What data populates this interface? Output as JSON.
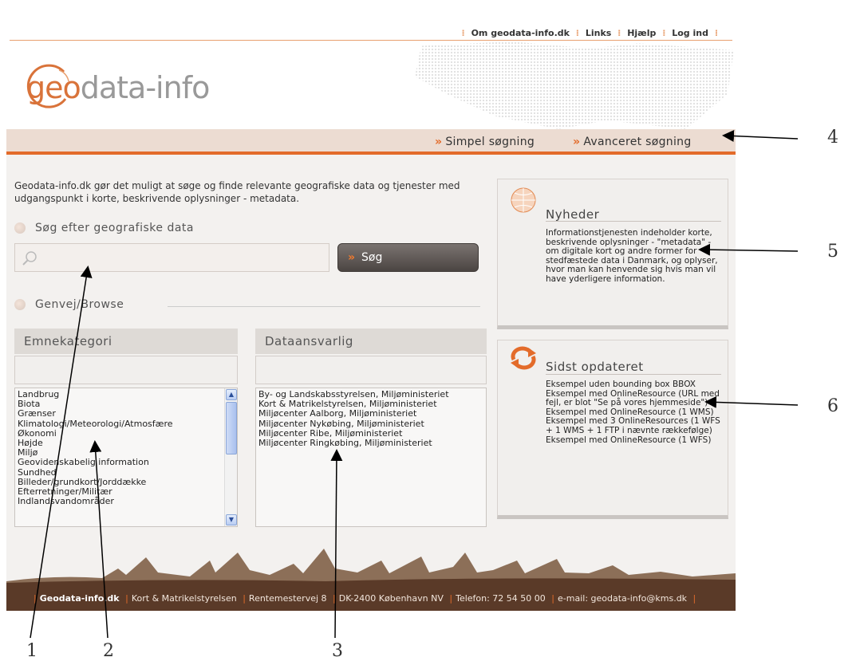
{
  "topnav": {
    "items": [
      "Om geodata-info.dk",
      "Links",
      "Hjælp",
      "Log ind"
    ]
  },
  "logo": {
    "prefix": "geo",
    "suffix": "data-info"
  },
  "searchstrip": {
    "simple": "Simpel søgning",
    "advanced": "Avanceret søgning"
  },
  "intro": "Geodata-info.dk gør det muligt at søge og finde relevante geografiske data og tjenester med udgangspunkt i korte, beskrivende oplysninger - metadata.",
  "search": {
    "heading": "Søg efter geografiske data",
    "value": "",
    "button": "Søg"
  },
  "browse": {
    "heading": "Genvej/Browse",
    "categories": {
      "title": "Emnekategori",
      "items": [
        "Landbrug",
        "Biota",
        "Grænser",
        "Klimatologi/Meteorologi/Atmosfære",
        "Økonomi",
        "Højde",
        "Miljø",
        "Geovidenskabelig information",
        "Sundhed",
        "Billeder/grundkort/Jorddække",
        "Efterretninger/Militær",
        "Indlandsvandområder"
      ]
    },
    "responsible": {
      "title": "Dataansvarlig",
      "items": [
        "By- og Landskabsstyrelsen, Miljøministeriet",
        "Kort & Matrikelstyrelsen, Miljøministeriet",
        "Miljøcenter Aalborg, Miljøministeriet",
        "Miljøcenter Nykøbing, Miljøministeriet",
        "Miljøcenter Ribe, Miljøministeriet",
        "Miljøcenter Ringkøbing, Miljøministeriet"
      ]
    }
  },
  "news": {
    "title": "Nyheder",
    "body": "Informationstjenesten indeholder korte, beskrivende oplysninger - \"metadata\" - om digitale kort og andre former for stedfæstede data i Danmark, og oplyser, hvor man kan henvende sig hvis man vil have yderligere information."
  },
  "updates": {
    "title": "Sidst opdateret",
    "items": [
      "Eksempel uden bounding box BBOX",
      "Eksempel med OnlineResource (URL med fejl, er blot \"Se på vores hjemmeside\")",
      "Eksempel med OnlineResource (1 WMS)",
      "Eksempel med 3 OnlineResources (1 WFS + 1 WMS + 1 FTP i nævnte rækkefølge)",
      "Eksempel med OnlineResource (1 WFS)"
    ]
  },
  "footer": {
    "site": "Geodata-info.dk",
    "org": "Kort & Matrikelstyrelsen",
    "street": "Rentemestervej 8",
    "city": "DK-2400 København NV",
    "phone": "Telefon: 72 54 50 00",
    "email": "e-mail: geodata-info@kms.dk"
  },
  "annotations": {
    "labels": [
      "1",
      "2",
      "3",
      "4",
      "5",
      "6"
    ]
  },
  "colors": {
    "accent": "#e36b2a",
    "footer": "#5a3a28",
    "strip": "#ecdcd2"
  }
}
